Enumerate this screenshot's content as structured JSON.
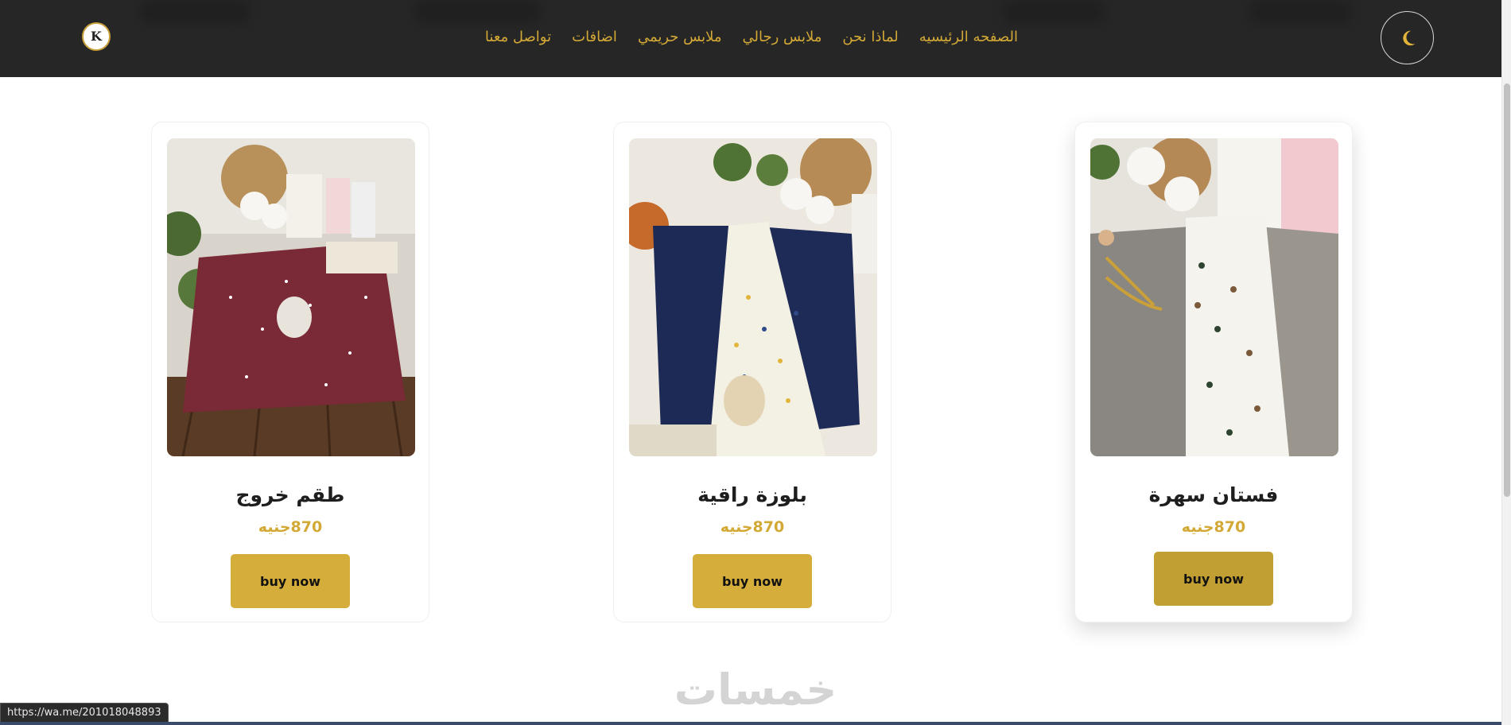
{
  "header": {
    "logo_text": "K",
    "nav_items": [
      "الصفحه الرئيسيه",
      "لماذا نحن",
      "ملابس رجالي",
      "ملابس حريمي",
      "اضافات",
      "تواصل معنا"
    ],
    "theme_toggle_icon": "moon-icon",
    "accent_color": "#d3a936",
    "background_color": "#262626"
  },
  "products": [
    {
      "title": "طقم خروج",
      "price": "870جنيه",
      "button_label": "buy now"
    },
    {
      "title": "بلوزة راقية",
      "price": "870جنيه",
      "button_label": "buy now"
    },
    {
      "title": "فستان سهرة",
      "price": "870جنيه",
      "button_label": "buy now"
    }
  ],
  "footer": {
    "watermark": "خمسات"
  },
  "status_bar": {
    "url": "https://wa.me/201018048893"
  },
  "colors": {
    "button": "#d4ad3a",
    "button_hover": "#c29f32",
    "title": "#1e1e1e"
  }
}
